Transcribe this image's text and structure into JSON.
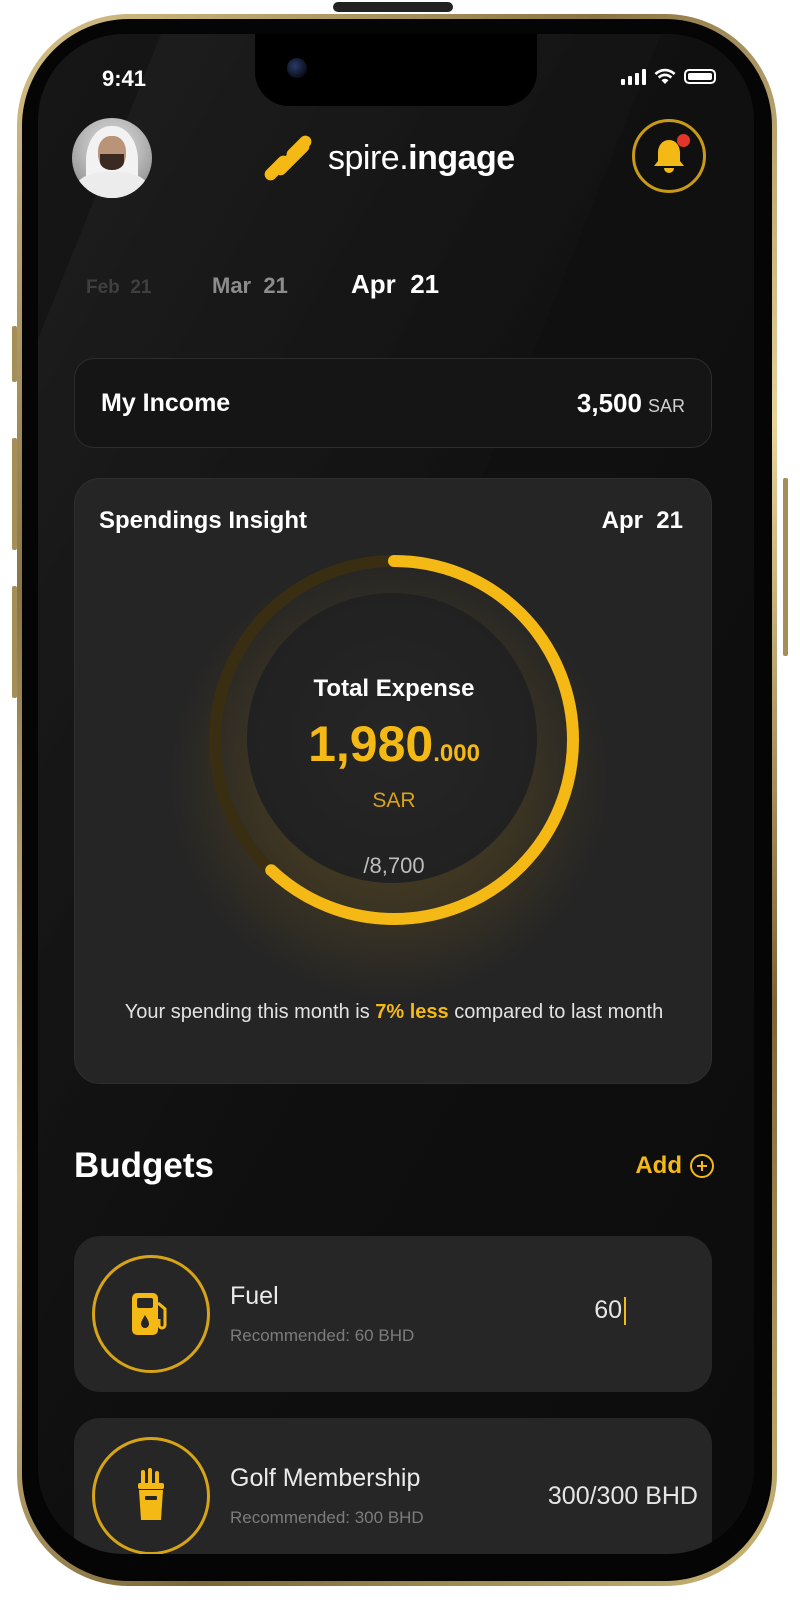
{
  "status_bar": {
    "time": "9:41"
  },
  "header": {
    "logo": {
      "light": "spire.",
      "bold": "ingage"
    },
    "icons": {
      "avatar": "user-avatar",
      "notification": "bell-icon"
    },
    "notification_dot_color": "#e5352a"
  },
  "months": [
    {
      "label": "Feb  21"
    },
    {
      "label": "Mar  21"
    },
    {
      "label": "Apr  21",
      "selected": true
    }
  ],
  "income": {
    "label": "My Income",
    "value": "3,500",
    "currency": "SAR"
  },
  "insight": {
    "title": "Spendings Insight",
    "month": "Apr  21",
    "total_label": "Total Expense",
    "total_int": "1,980",
    "total_dec": ".000",
    "currency": "SAR",
    "limit": "/8,700",
    "progress_fraction": 0.62,
    "note_before": "Your spending this month is ",
    "note_highlight": "7% less",
    "note_after": " compared to last month"
  },
  "budgets": {
    "title": "Budgets",
    "add_label": "Add",
    "items": [
      {
        "name": "Fuel",
        "recommended": "Recommended: 60 BHD",
        "amount": "60",
        "icon": "fuel-pump-icon"
      },
      {
        "name": "Golf Membership",
        "recommended": "Recommended: 300 BHD",
        "amount": "300/300 BHD",
        "icon": "golf-bag-icon"
      }
    ]
  },
  "colors": {
    "accent": "#f5b915",
    "card": "#252525",
    "background": "#111111"
  }
}
